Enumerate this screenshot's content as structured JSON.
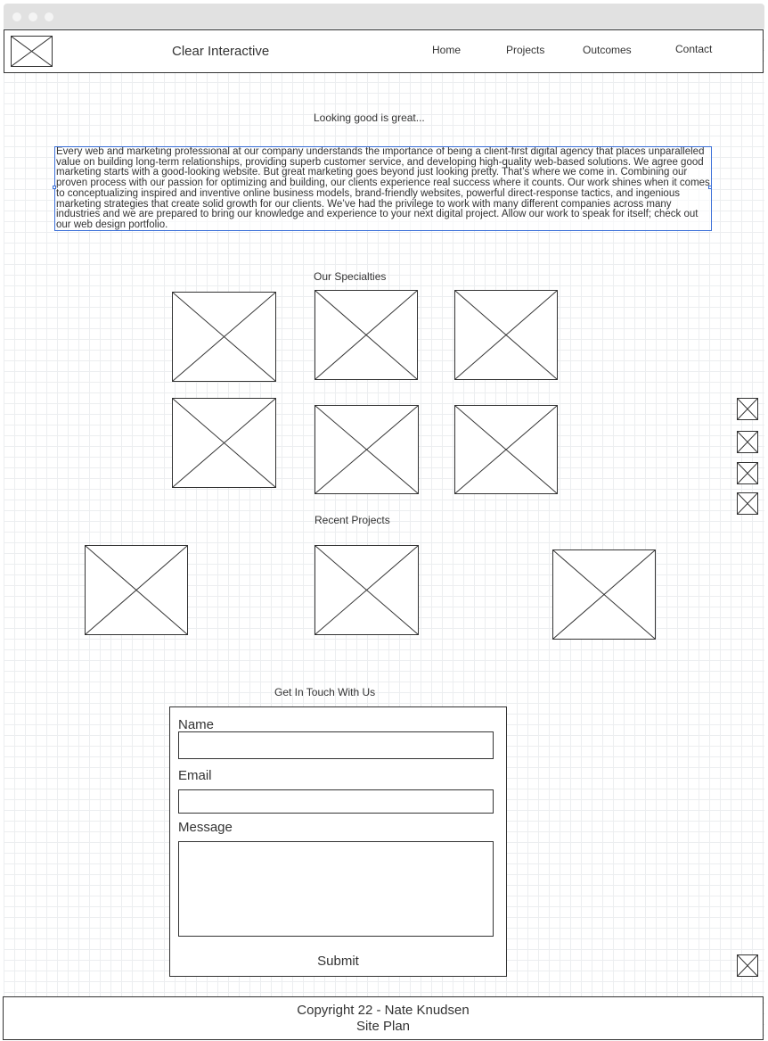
{
  "nav": {
    "brand": "Clear Interactive",
    "links": [
      "Home",
      "Projects",
      "Outcomes",
      "Contact"
    ]
  },
  "intro": {
    "heading": "Looking good is great...",
    "paragraph": "Every web and marketing professional at our company understands the importance of being a client-first digital agency that places unparalleled value on building long-term relationships, providing superb customer service, and developing high-quality web-based solutions. We agree good marketing starts with a good-looking website. But great marketing goes beyond just looking pretty. That’s where we come in. Combining our proven process with our passion for optimizing and building, our clients experience real success where it counts. Our work shines when it comes to conceptualizing inspired and inventive online business models, brand-friendly websites, powerful direct-response tactics, and ingenious marketing strategies that create solid growth for our clients. We’ve had the privilege to work with many different companies across many industries and we are prepared to bring our knowledge and experience to your next digital project. Allow our work to speak for itself; check out our web design portfolio."
  },
  "specialties": {
    "heading": "Our Specialties"
  },
  "projects": {
    "heading": "Recent Projects"
  },
  "contact": {
    "heading": "Get In Touch With Us",
    "name_label": "Name",
    "email_label": "Email",
    "message_label": "Message",
    "submit_label": "Submit"
  },
  "footer": {
    "copyright": "Copyright 22 - Nate Knudsen",
    "subtitle": "Site Plan"
  }
}
